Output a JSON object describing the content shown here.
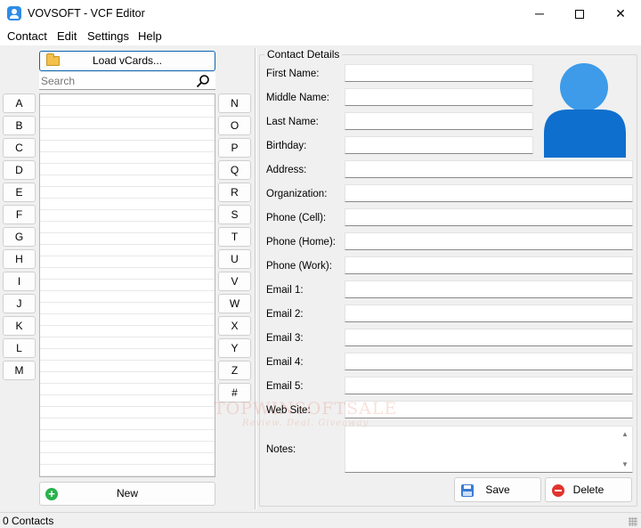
{
  "window": {
    "title": "VOVSOFT - VCF Editor",
    "minimize": "─",
    "close": "✕"
  },
  "menu": [
    "Contact",
    "Edit",
    "Settings",
    "Help"
  ],
  "left": {
    "load_button": "Load vCards...",
    "search_placeholder": "Search",
    "new_button": "New",
    "letters_left": [
      "A",
      "B",
      "C",
      "D",
      "E",
      "F",
      "G",
      "H",
      "I",
      "J",
      "K",
      "L",
      "M"
    ],
    "letters_right": [
      "N",
      "O",
      "P",
      "Q",
      "R",
      "S",
      "T",
      "U",
      "V",
      "W",
      "X",
      "Y",
      "Z",
      "#"
    ]
  },
  "details": {
    "group_title": "Contact Details",
    "fields": [
      {
        "label": "First Name:",
        "value": ""
      },
      {
        "label": "Middle Name:",
        "value": ""
      },
      {
        "label": "Last Name:",
        "value": ""
      },
      {
        "label": "Birthday:",
        "value": ""
      },
      {
        "label": "Address:",
        "value": ""
      },
      {
        "label": "Organization:",
        "value": ""
      },
      {
        "label": "Phone (Cell):",
        "value": ""
      },
      {
        "label": "Phone (Home):",
        "value": ""
      },
      {
        "label": "Phone (Work):",
        "value": ""
      },
      {
        "label": "Email 1:",
        "value": ""
      },
      {
        "label": "Email 2:",
        "value": ""
      },
      {
        "label": "Email 3:",
        "value": ""
      },
      {
        "label": "Email 4:",
        "value": ""
      },
      {
        "label": "Email 5:",
        "value": ""
      },
      {
        "label": "Web Site:",
        "value": ""
      }
    ],
    "notes_label": "Notes:",
    "notes_value": "",
    "save_button": "Save",
    "delete_button": "Delete"
  },
  "watermark": {
    "title": "TOPWINSOFTSALE",
    "subtitle": "Review. Deal. Giveaway"
  },
  "status": "0 Contacts",
  "icons": {
    "app": "user-card-icon",
    "load": "folder-open-icon",
    "search": "search-icon",
    "new": "plus-circle-icon",
    "save": "floppy-disk-icon",
    "delete": "minus-circle-icon",
    "avatar": "person-silhouette-icon"
  },
  "colors": {
    "accent": "#0a64b0",
    "avatar": "#1976d2",
    "new_icon": "#2ab24b",
    "delete_icon": "#e0342e"
  }
}
